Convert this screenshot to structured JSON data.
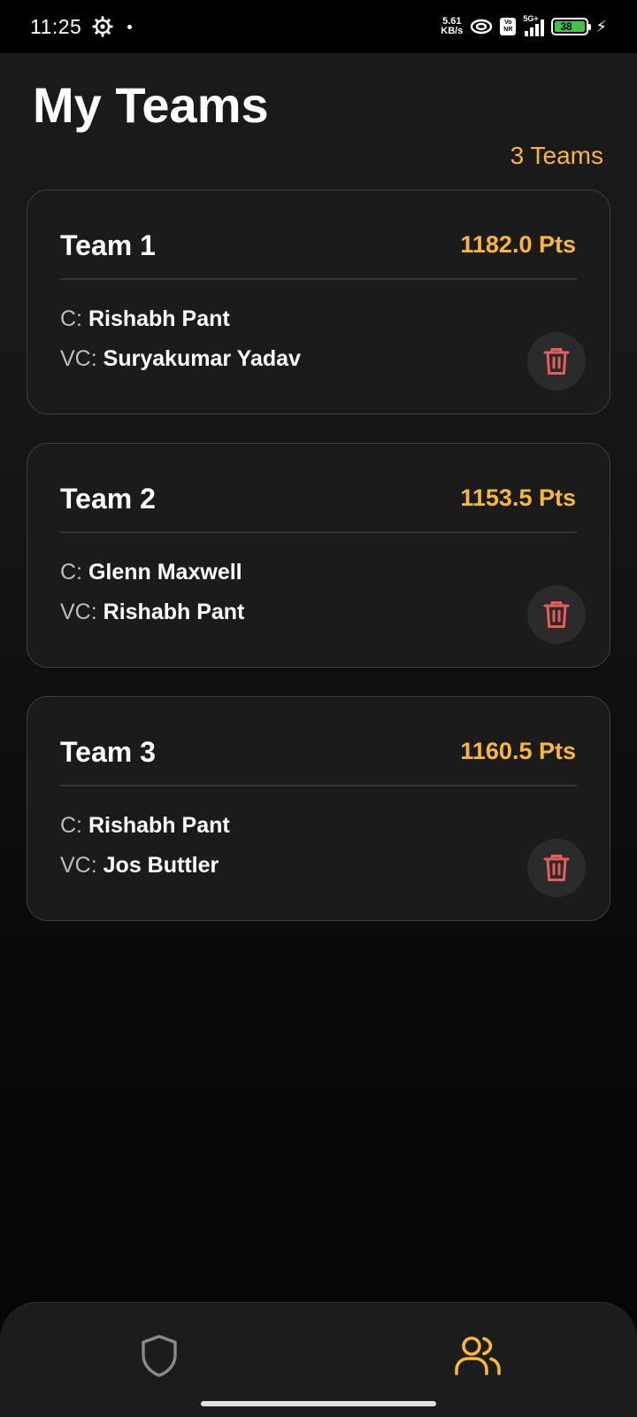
{
  "status_bar": {
    "time": "11:25",
    "speed_value": "5.61",
    "speed_unit": "KB/s",
    "volte_top": "Vo",
    "volte_bottom": "NR",
    "network": "5G+",
    "battery_level": "38"
  },
  "header": {
    "title": "My Teams",
    "count": "3 Teams"
  },
  "teams": [
    {
      "name": "Team 1",
      "points": "1182.0 Pts",
      "captain_prefix": "C:",
      "captain": "Rishabh Pant",
      "vice_prefix": "VC:",
      "vice_captain": "Suryakumar Yadav"
    },
    {
      "name": "Team 2",
      "points": "1153.5 Pts",
      "captain_prefix": "C:",
      "captain": "Glenn Maxwell",
      "vice_prefix": "VC:",
      "vice_captain": "Rishabh Pant"
    },
    {
      "name": "Team 3",
      "points": "1160.5 Pts",
      "captain_prefix": "C:",
      "captain": "Rishabh Pant",
      "vice_prefix": "VC:",
      "vice_captain": "Jos Buttler"
    }
  ],
  "bottom_nav": {
    "items": [
      {
        "icon": "shield-icon",
        "active": false
      },
      {
        "icon": "users-icon",
        "active": true
      }
    ]
  },
  "colors": {
    "accent": "#f7b839",
    "delete": "#e85c5c",
    "card_bg": "#1b1b1b",
    "inactive_icon": "#8a8a8a"
  }
}
